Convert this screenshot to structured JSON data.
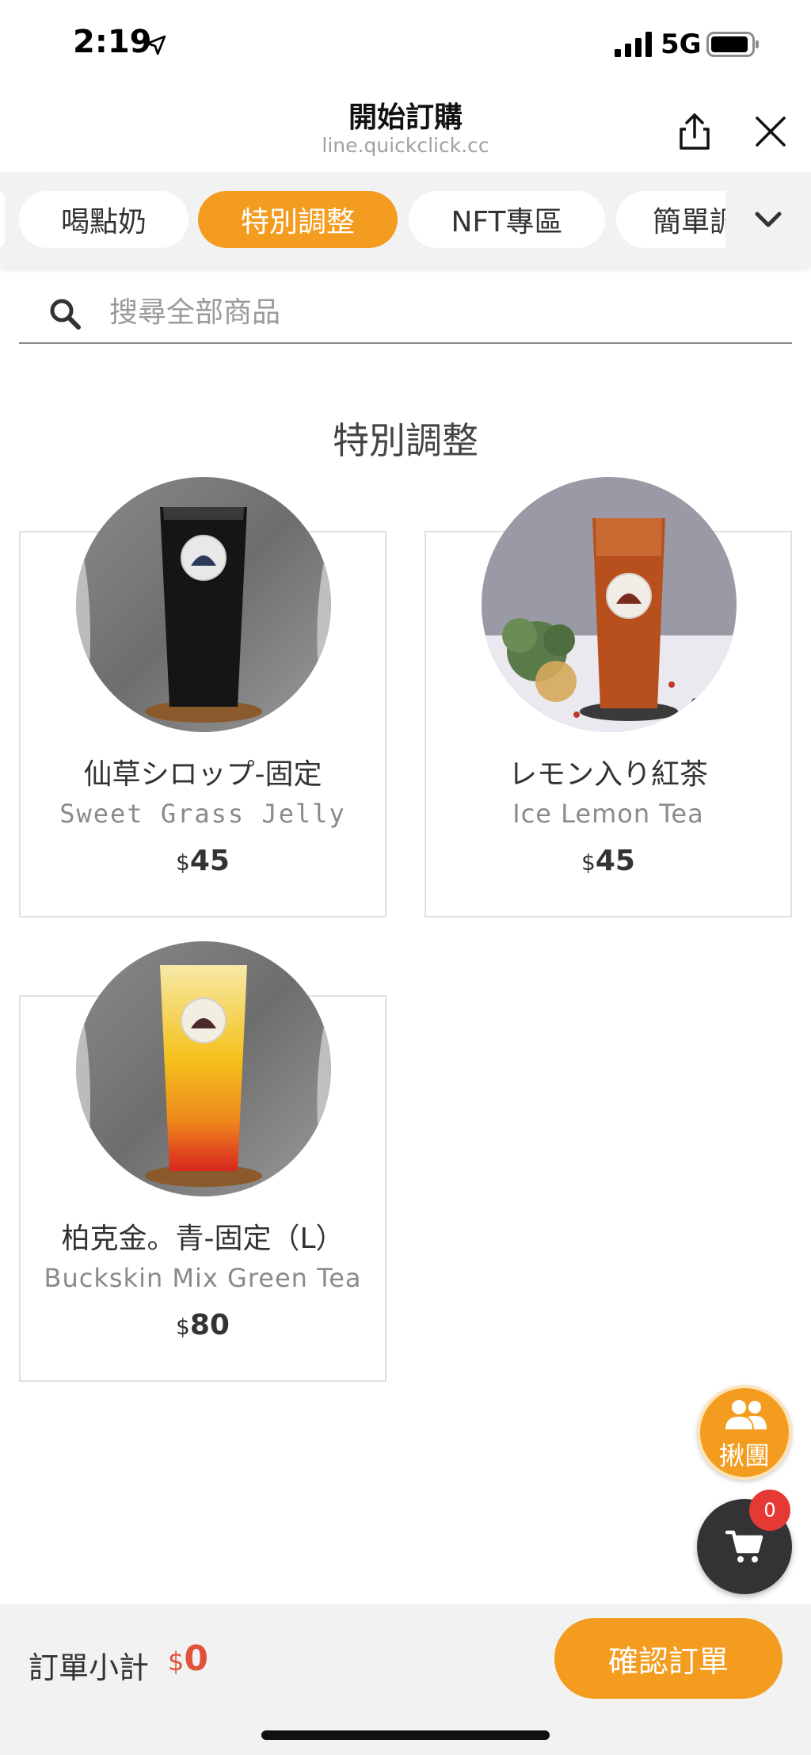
{
  "status": {
    "time": "2:19",
    "network": "5G"
  },
  "header": {
    "title": "開始訂購",
    "url": "line.quickclick.cc"
  },
  "categories": [
    {
      "label": "喝點奶",
      "active": false
    },
    {
      "label": "特別調整",
      "active": true
    },
    {
      "label": "NFT專區",
      "active": false
    },
    {
      "label": "簡單調",
      "active": false
    }
  ],
  "search": {
    "placeholder": "搜尋全部商品"
  },
  "section": {
    "title": "特別調整"
  },
  "products": [
    {
      "name": "仙草シロップ-固定",
      "en_name": "Sweet Grass Jelly",
      "currency": "$",
      "price": "45"
    },
    {
      "name": "レモン入り紅茶",
      "en_name": "Ice Lemon Tea",
      "currency": "$",
      "price": "45"
    },
    {
      "name": "柏克金。青-固定（L）",
      "en_name": "Buckskin Mix Green Tea",
      "currency": "$",
      "price": "80"
    }
  ],
  "group_order": {
    "label": "揪團"
  },
  "cart": {
    "count": "0"
  },
  "footer": {
    "subtotal_label": "訂單小計",
    "currency": "$",
    "subtotal": "0",
    "confirm_label": "確認訂單"
  },
  "colors": {
    "accent": "#f39c1f",
    "price_red": "#e0523a",
    "badge_red": "#e53935"
  }
}
